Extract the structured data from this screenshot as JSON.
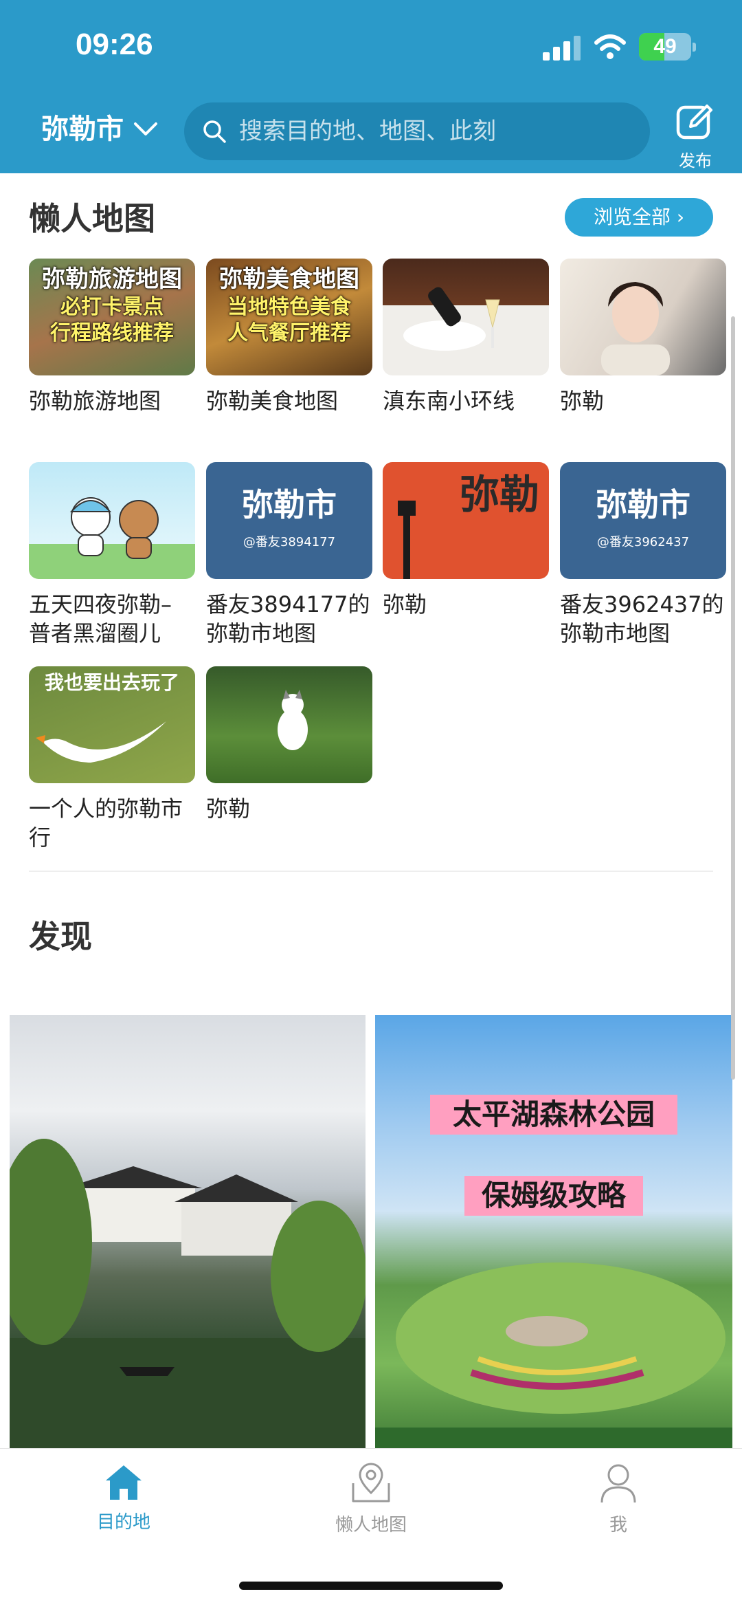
{
  "status_bar": {
    "time": "09:26",
    "battery": "49"
  },
  "header": {
    "city": "弥勒市",
    "search_placeholder": "搜索目的地、地图、此刻",
    "publish_label": "发布"
  },
  "lazy_maps": {
    "title": "懒人地图",
    "browse_all": "浏览全部",
    "items": [
      {
        "name": "弥勒旅游地图",
        "thumb_title": "弥勒旅游地图",
        "thumb_line1": "必打卡景点",
        "thumb_line2": "行程路线推荐"
      },
      {
        "name": "弥勒美食地图",
        "thumb_title": "弥勒美食地图",
        "thumb_line1": "当地特色美食",
        "thumb_line2": "人气餐厅推荐"
      },
      {
        "name": "滇东南小环线"
      },
      {
        "name": "弥勒"
      },
      {
        "name": "五天四夜弥勒–\n普者黑溜圈儿"
      },
      {
        "name": "番友3894177的\n弥勒市地图",
        "thumb_city": "弥勒市",
        "thumb_user": "@番友3894177"
      },
      {
        "name": "弥勒",
        "thumb_text": "弥勒"
      },
      {
        "name": "番友3962437的\n弥勒市地图",
        "thumb_city": "弥勒市",
        "thumb_user": "@番友3962437"
      },
      {
        "name": "一个人的弥勒市\n行",
        "thumb_text": "我也要出去玩了"
      },
      {
        "name": "弥勒"
      }
    ]
  },
  "discover": {
    "title": "发现",
    "posts": [
      {
        "image": "water-town-photo"
      },
      {
        "image": "park-photo",
        "poster_line1": "太平湖森林公园",
        "poster_line2": "保姆级攻略"
      }
    ]
  },
  "tabbar": {
    "items": [
      {
        "label": "目的地",
        "icon": "home-icon",
        "active": true
      },
      {
        "label": "懒人地图",
        "icon": "map-pin-icon",
        "active": false
      },
      {
        "label": "我",
        "icon": "user-icon",
        "active": false
      }
    ],
    "active_color": "#2b9ac9",
    "inactive_color": "#9a9a9a"
  },
  "colors": {
    "header": "#2b9ac9",
    "search_bg": "#1f86b3",
    "button": "#2ea7d8"
  }
}
